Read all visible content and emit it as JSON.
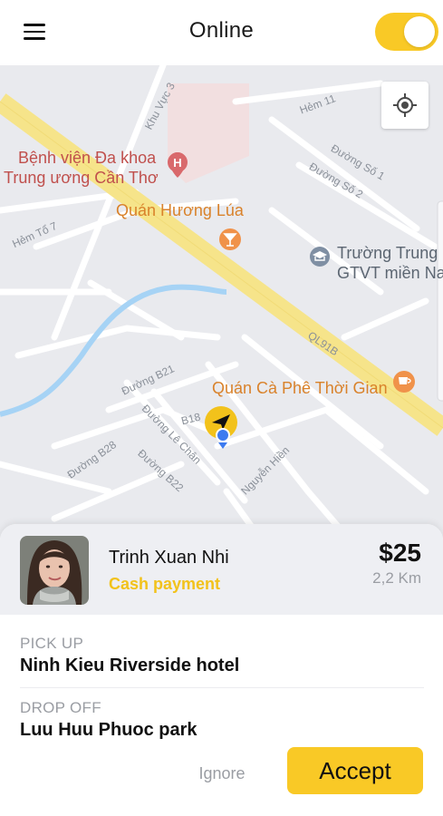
{
  "header": {
    "title": "Online",
    "menu_icon": "hamburger-menu-icon",
    "online_toggle": {
      "on": true,
      "color": "#f9c926"
    }
  },
  "map": {
    "pois": {
      "hospital": [
        "Bệnh viện Đa khoa",
        "Trung ương Cần Thơ"
      ],
      "restaurant": "Quán Hương Lúa",
      "school": [
        "Trường Trung",
        "GTVT miền Na"
      ],
      "cafe": "Quán Cà Phê Thời Gian"
    },
    "streets": {
      "khu_vuc_3": "Khu Vực 3",
      "hem_11": "Hẻm 11",
      "duong_so_1": "Đường Số 1",
      "duong_so_2": "Đường Số 2",
      "hem_to_7": "Hẻm Tổ 7",
      "ql91b": "QL91B",
      "duong_b21": "Đường B21",
      "b18": "B18",
      "duong_le_chan": "Đường Lê Chân",
      "duong_b28": "Đường B28",
      "duong_b22": "Đường B22",
      "nguyen_hien": "Nguyễn Hiền"
    },
    "locate_icon": "my-location-icon"
  },
  "ride_request": {
    "passenger_name": "Trinh Xuan Nhi",
    "payment_method": "Cash payment",
    "price": "$25",
    "distance": "2,2 Km",
    "pickup_label": "PICK UP",
    "pickup_value": "Ninh Kieu Riverside hotel",
    "dropoff_label": "DROP OFF",
    "dropoff_value": "Luu Huu Phuoc park",
    "ignore_label": "Ignore",
    "accept_label": "Accept"
  },
  "colors": {
    "accent": "#f9c926",
    "payment_text": "#f2c21b",
    "map_background": "#e9eaee",
    "highway": "#f6e48a",
    "river": "#a6d3f5"
  }
}
